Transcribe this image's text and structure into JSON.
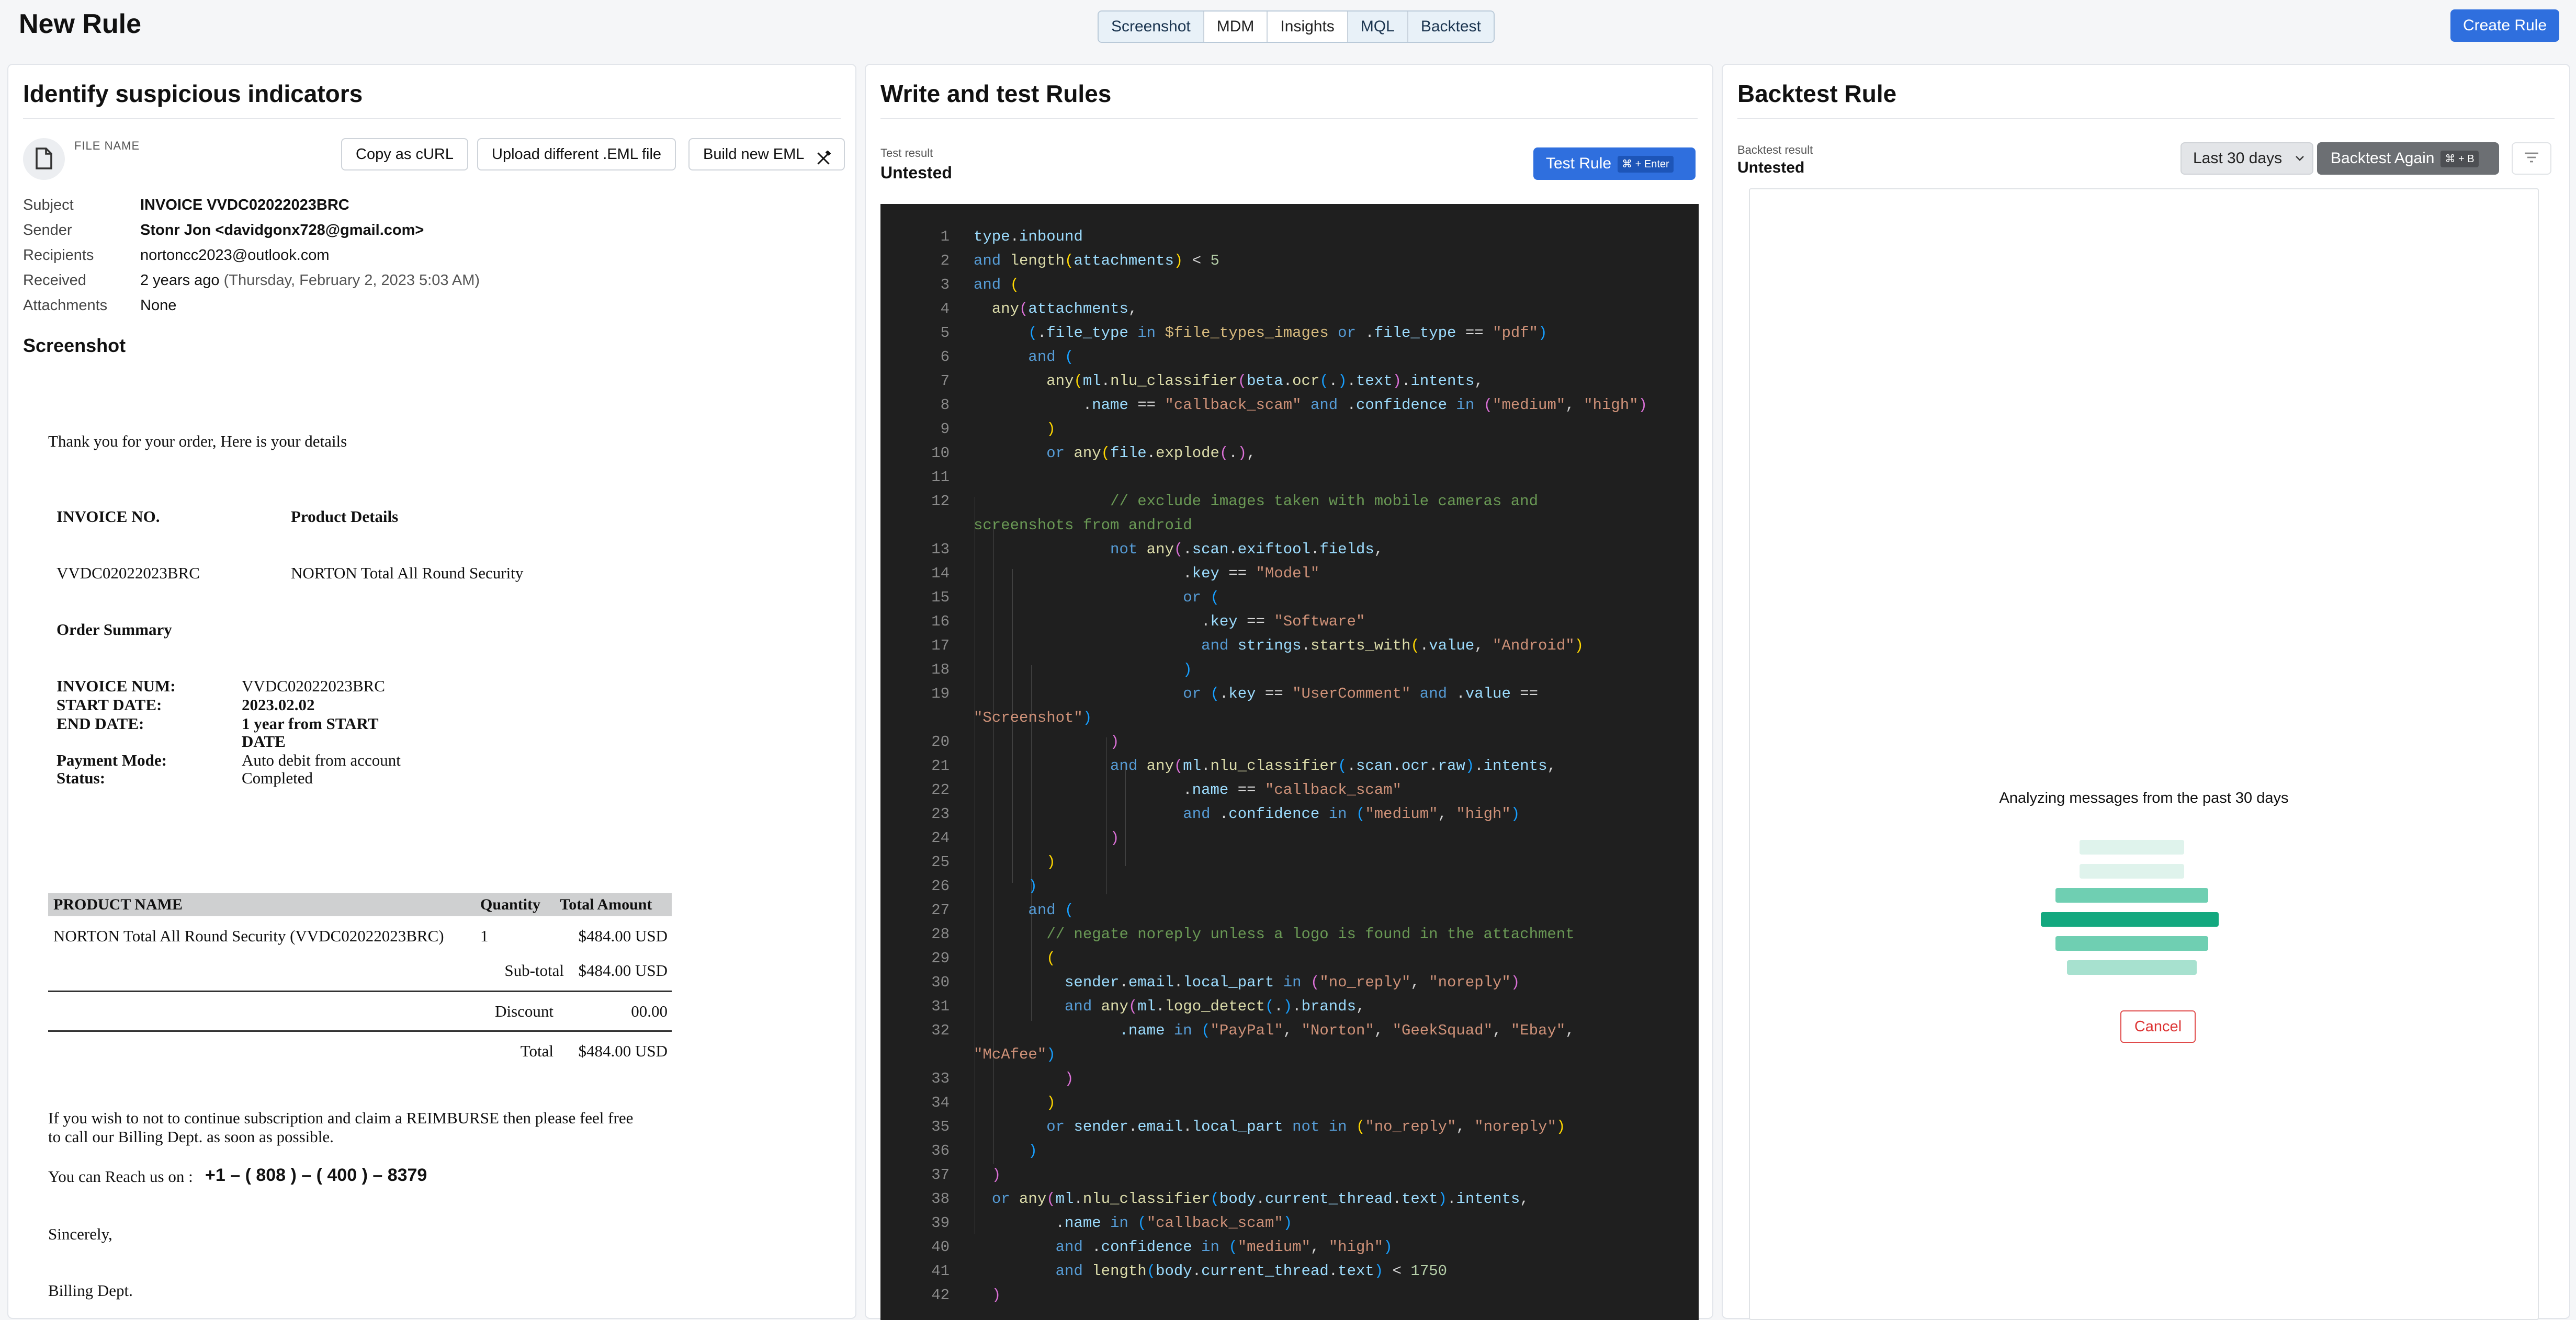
{
  "header": {
    "title": "New Rule",
    "tabs": [
      "Screenshot",
      "MDM",
      "Insights",
      "MQL",
      "Backtest"
    ],
    "create_label": "Create Rule"
  },
  "left": {
    "title": "Identify suspicious indicators",
    "file_label": "FILE NAME",
    "buttons": {
      "curl": "Copy as cURL",
      "upload": "Upload different .EML file",
      "build": "Build new EML"
    },
    "meta": {
      "subject_label": "Subject",
      "subject": "INVOICE VVDC02022023BRC",
      "sender_label": "Sender",
      "sender": "Stonr Jon <davidgonx728@gmail.com>",
      "recipients_label": "Recipients",
      "recipients": "nortoncc2023@outlook.com",
      "received_label": "Received",
      "received": "2 years ago",
      "received_detail": "(Thursday, February 2, 2023 5:03 AM)",
      "attachments_label": "Attachments",
      "attachments": "None"
    },
    "screenshot_title": "Screenshot",
    "email": {
      "thanks": "Thank you for your order, Here is your details",
      "invoice_no_label": "INVOICE NO.",
      "product_details_label": "Product Details",
      "invoice_no": "VVDC02022023BRC",
      "product_name": "NORTON Total All Round Security",
      "order_summary": "Order Summary",
      "inv_num_label": "INVOICE NUM:",
      "inv_num": "VVDC02022023BRC",
      "start_label": "START DATE:",
      "start": "2023.02.02",
      "end_label": "END DATE:",
      "end_1": "1 year from START",
      "end_2": "DATE",
      "payment_label": "Payment Mode:",
      "payment": "Auto debit from account",
      "status_label": "Status:",
      "status": "Completed",
      "table_headers": [
        "PRODUCT NAME",
        "Quantity",
        "Total Amount"
      ],
      "row": {
        "name": "NORTON Total All Round Security (VVDC02022023BRC)",
        "qty": "1",
        "amount": "$484.00 USD"
      },
      "subtotal_label": "Sub-total",
      "subtotal": "$484.00 USD",
      "discount_label": "Discount",
      "discount": "00.00",
      "total_label": "Total",
      "total": "$484.00 USD",
      "reimburse_1": "If you wish to not to continue subscription and claim a REIMBURSE then please feel free",
      "reimburse_2": "to call our Billing Dept. as soon as possible.",
      "reach_label": "You can Reach us on :",
      "phone": "+1 – ( 808 ) – ( 400 ) – 8379",
      "sincerely": "Sincerely,",
      "signature": "Billing Dept."
    }
  },
  "middle": {
    "title": "Write and test Rules",
    "result_label": "Test result",
    "result_value": "Untested",
    "test_label": "Test Rule",
    "test_kbd": "⌘ + Enter"
  },
  "right": {
    "title": "Backtest Rule",
    "result_label": "Backtest result",
    "result_value": "Untested",
    "range_label": "Last 30 days",
    "again_label": "Backtest Again",
    "again_kbd": "⌘ + B",
    "analyzing": "Analyzing messages from the past 30 days",
    "cancel": "Cancel"
  },
  "colors": {
    "accent": "#2f6fde",
    "code_bg": "#1f1f1f",
    "progress": "#13a87f"
  }
}
